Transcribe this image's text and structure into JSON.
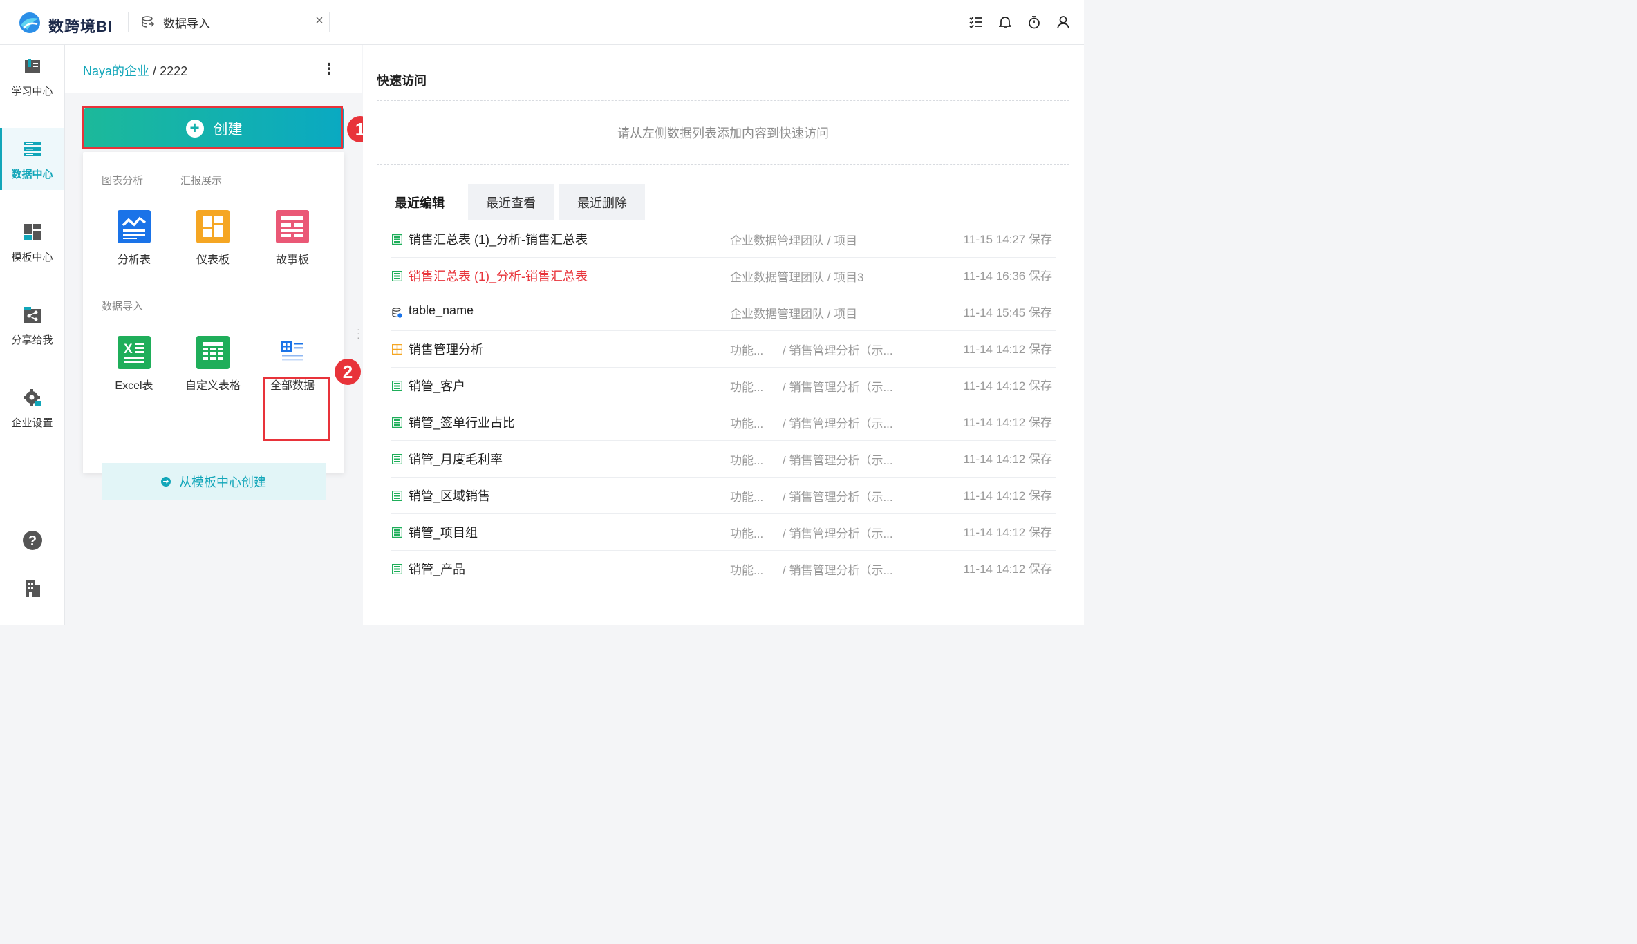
{
  "app": {
    "logo_text": "数跨境BI"
  },
  "tab": {
    "label": "数据导入",
    "close": "×"
  },
  "topbar_icons": [
    "tasklist-icon",
    "bell-icon",
    "timer-icon",
    "user-icon"
  ],
  "leftnav": [
    {
      "label": "学习中心",
      "icon": "book-icon",
      "active": false
    },
    {
      "label": "数据中心",
      "icon": "data-center-icon",
      "active": true
    },
    {
      "label": "模板中心",
      "icon": "template-icon",
      "active": false
    },
    {
      "label": "分享给我",
      "icon": "share-icon",
      "active": false
    },
    {
      "label": "企业设置",
      "icon": "gear-icon",
      "active": false
    }
  ],
  "breadcrumb": {
    "root": "Naya的企业",
    "sep": "/",
    "current": "2222",
    "more": "⋮"
  },
  "create": {
    "label": "创建",
    "badge1": "1",
    "badge2": "2",
    "sections": {
      "chart_analysis": "图表分析",
      "report_display": "汇报展示",
      "data_import": "数据导入"
    },
    "tiles_top": [
      "分析表",
      "仪表板",
      "故事板"
    ],
    "tiles_bottom": [
      "Excel表",
      "自定义表格",
      "全部数据"
    ],
    "template_btn": "从模板中心创建"
  },
  "quick_access": {
    "title": "快速访问",
    "empty_text": "请从左侧数据列表添加内容到快速访问"
  },
  "recent_tabs": [
    "最近编辑",
    "最近查看",
    "最近删除"
  ],
  "recent_items": [
    {
      "name": "销售汇总表 (1)_分析-销售汇总表",
      "path": "企业数据管理团队 / 项目",
      "path2": "",
      "time": "11-15 14:27 保存",
      "icon": "sheet-icon",
      "red": false
    },
    {
      "name": "销售汇总表 (1)_分析-销售汇总表",
      "path": "企业数据管理团队 / 项目3",
      "path2": "",
      "time": "11-14 16:36 保存",
      "icon": "sheet-icon",
      "red": true
    },
    {
      "name": "table_name",
      "path": "企业数据管理团队 / 项目",
      "path2": "",
      "time": "11-14 15:45 保存",
      "icon": "dataset-icon",
      "red": false
    },
    {
      "name": "销售管理分析",
      "path": "功能...",
      "path2": "/ 销售管理分析（示...",
      "time": "11-14 14:12 保存",
      "icon": "dashboard-icon",
      "red": false
    },
    {
      "name": "销管_客户",
      "path": "功能...",
      "path2": "/ 销售管理分析（示...",
      "time": "11-14 14:12 保存",
      "icon": "sheet-icon",
      "red": false
    },
    {
      "name": "销管_签单行业占比",
      "path": "功能...",
      "path2": "/ 销售管理分析（示...",
      "time": "11-14 14:12 保存",
      "icon": "sheet-icon",
      "red": false
    },
    {
      "name": "销管_月度毛利率",
      "path": "功能...",
      "path2": "/ 销售管理分析（示...",
      "time": "11-14 14:12 保存",
      "icon": "sheet-icon",
      "red": false
    },
    {
      "name": "销管_区域销售",
      "path": "功能...",
      "path2": "/ 销售管理分析（示...",
      "time": "11-14 14:12 保存",
      "icon": "sheet-icon",
      "red": false
    },
    {
      "name": "销管_项目组",
      "path": "功能...",
      "path2": "/ 销售管理分析（示...",
      "time": "11-14 14:12 保存",
      "icon": "sheet-icon",
      "red": false
    },
    {
      "name": "销管_产品",
      "path": "功能...",
      "path2": "/ 销售管理分析（示...",
      "time": "11-14 14:12 保存",
      "icon": "sheet-icon",
      "red": false
    }
  ],
  "colors": {
    "accent": "#12a6b9",
    "highlight": "#e8333a",
    "sheet_green": "#1fae5a",
    "dashboard_orange": "#f5a623"
  }
}
